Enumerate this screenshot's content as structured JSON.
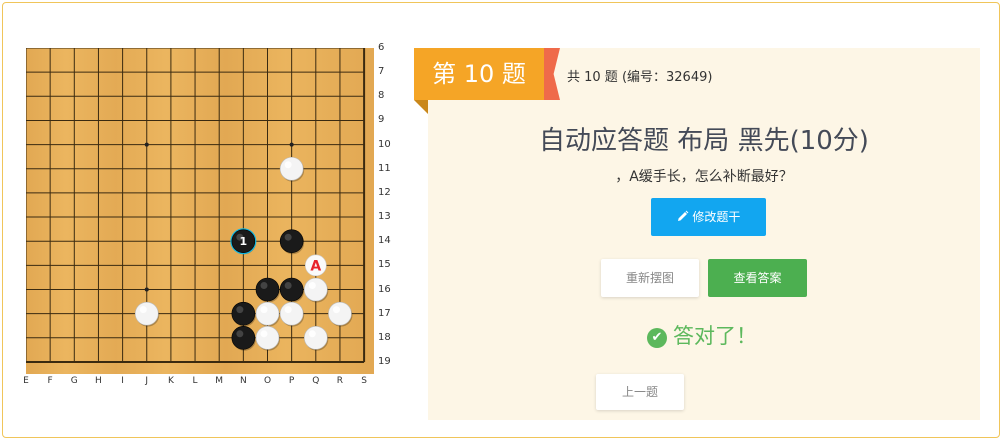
{
  "board": {
    "col_labels": [
      "E",
      "F",
      "G",
      "H",
      "I",
      "J",
      "K",
      "L",
      "M",
      "N",
      "O",
      "P",
      "Q",
      "R",
      "S"
    ],
    "row_labels": [
      "6",
      "7",
      "8",
      "9",
      "10",
      "11",
      "12",
      "13",
      "14",
      "15",
      "16",
      "17",
      "18",
      "19"
    ],
    "star_points": [
      {
        "col": "J",
        "row": 10
      },
      {
        "col": "P",
        "row": 10
      },
      {
        "col": "J",
        "row": 16
      }
    ],
    "stones": [
      {
        "col": "P",
        "row": 11,
        "color": "white"
      },
      {
        "col": "N",
        "row": 14,
        "color": "black",
        "label": "1",
        "last_move": true
      },
      {
        "col": "P",
        "row": 14,
        "color": "black"
      },
      {
        "col": "O",
        "row": 16,
        "color": "black"
      },
      {
        "col": "P",
        "row": 16,
        "color": "black"
      },
      {
        "col": "Q",
        "row": 16,
        "color": "white"
      },
      {
        "col": "J",
        "row": 17,
        "color": "white"
      },
      {
        "col": "N",
        "row": 17,
        "color": "black"
      },
      {
        "col": "O",
        "row": 17,
        "color": "white"
      },
      {
        "col": "P",
        "row": 17,
        "color": "white"
      },
      {
        "col": "R",
        "row": 17,
        "color": "white"
      },
      {
        "col": "N",
        "row": 18,
        "color": "black"
      },
      {
        "col": "O",
        "row": 18,
        "color": "white"
      },
      {
        "col": "Q",
        "row": 18,
        "color": "white"
      }
    ],
    "markers": [
      {
        "col": "Q",
        "row": 15,
        "label": "A",
        "color": "#e8222b"
      }
    ],
    "colors": {
      "black_stone": "#1a1a1a",
      "white_stone": "#f4f4f4",
      "last_move_ring": "#13b6e0",
      "grid": "#3a2a10"
    }
  },
  "problem": {
    "ribbon": "第 10 题",
    "meta": "共 10 题 (编号：32649)",
    "title": "自动应答题 布局 黑先(10分)",
    "question": "，A缓手长，怎么补断最好？"
  },
  "buttons": {
    "edit": "修改题干",
    "reset": "重新摆图",
    "answer": "查看答案",
    "prev": "上一题"
  },
  "status": {
    "result": "答对了！",
    "icon": "check-circle-icon"
  },
  "colors": {
    "ribbon": "#f5a526",
    "edit_button": "#12a6f0",
    "answer_button": "#4caf50",
    "success": "#5cb85c",
    "panel_bg": "#fdf6e6",
    "frame": "#f0c55a"
  }
}
